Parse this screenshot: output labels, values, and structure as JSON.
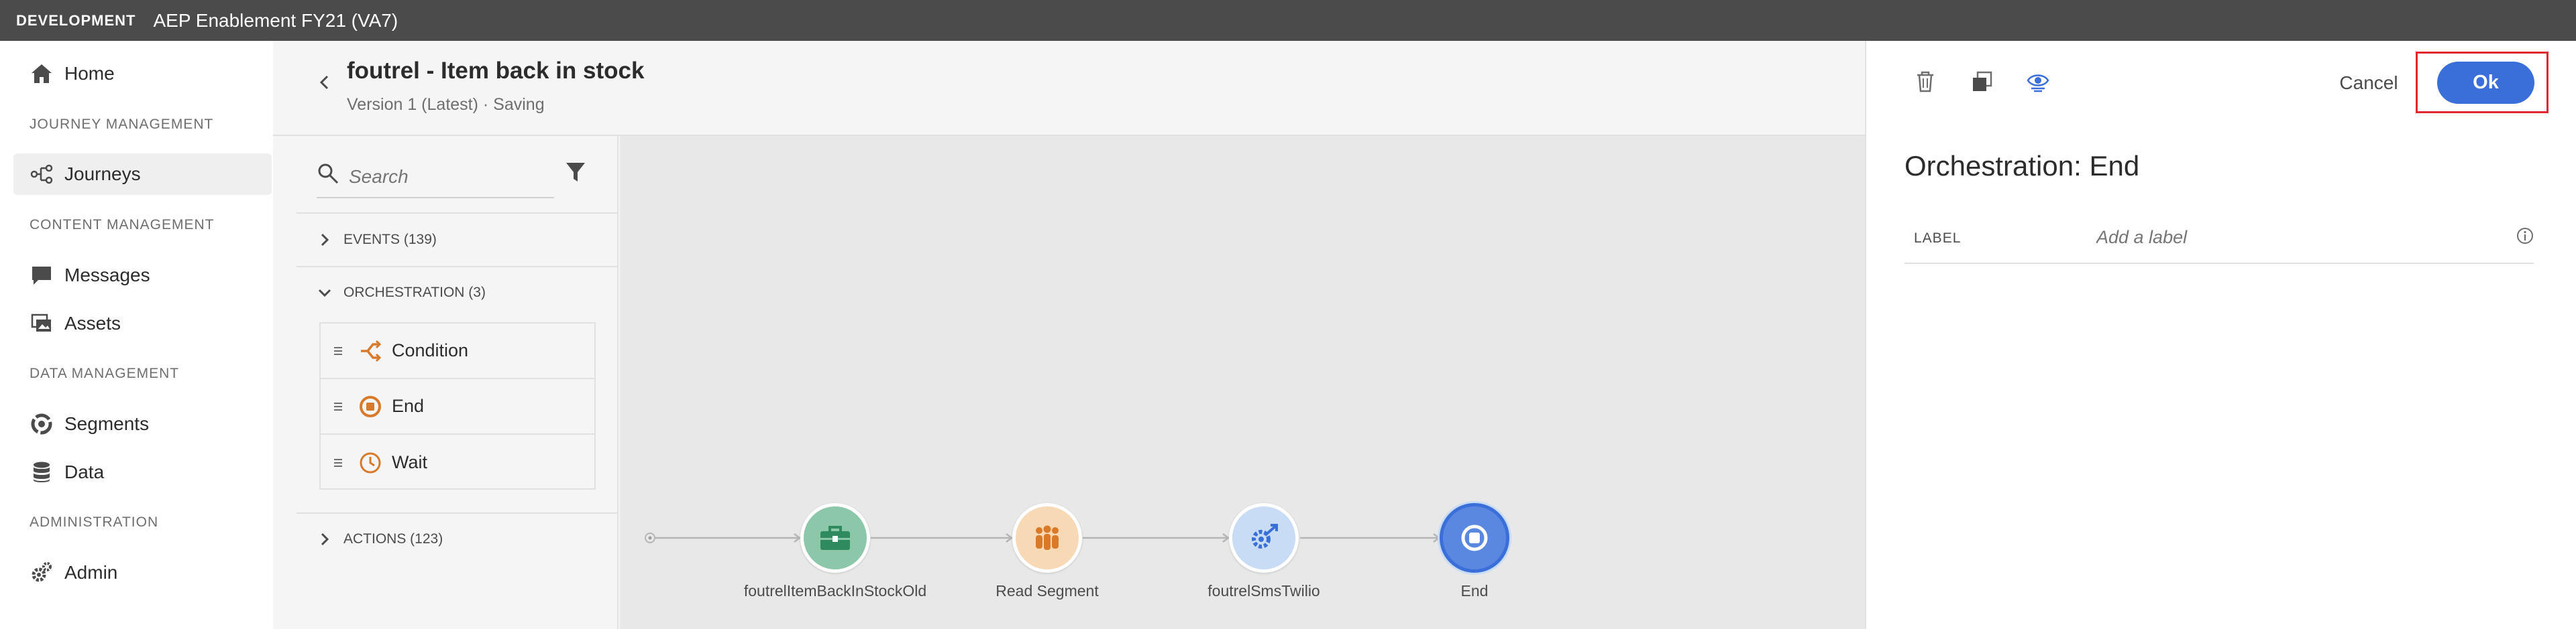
{
  "topbar": {
    "environment": "DEVELOPMENT",
    "organization": "AEP Enablement FY21 (VA7)"
  },
  "nav": {
    "home": "Home",
    "section_journey": "JOURNEY MANAGEMENT",
    "journeys": "Journeys",
    "section_content": "CONTENT MANAGEMENT",
    "messages": "Messages",
    "assets": "Assets",
    "section_data": "DATA MANAGEMENT",
    "segments": "Segments",
    "data": "Data",
    "section_admin": "ADMINISTRATION",
    "admin": "Admin"
  },
  "journey": {
    "title": "foutrel - Item back in stock",
    "subtitle": "Version 1 (Latest) · Saving"
  },
  "palette": {
    "search_placeholder": "Search",
    "events": "EVENTS (139)",
    "orchestration": "ORCHESTRATION (3)",
    "orchestration_items": [
      "Condition",
      "End",
      "Wait"
    ],
    "actions": "ACTIONS (123)"
  },
  "canvas": {
    "nodes": [
      {
        "label": "foutrelItemBackInStockOld",
        "icon": "briefcase-icon",
        "color": "#8bc7a8"
      },
      {
        "label": "Read Segment",
        "icon": "people-icon",
        "color": "#f7d9b5"
      },
      {
        "label": "foutrelSmsTwilio",
        "icon": "gear-arrow-icon",
        "color": "#c8dcf5"
      },
      {
        "label": "End",
        "icon": "stop-icon",
        "color": "#5a87e0"
      }
    ]
  },
  "panel": {
    "cancel_label": "Cancel",
    "ok_label": "Ok",
    "title": "Orchestration: End",
    "label_caption": "LABEL",
    "label_placeholder": "Add a label"
  },
  "colors": {
    "accent": "#3a6ed8",
    "highlight": "#e0282e",
    "orchestration_icon": "#d9792a"
  }
}
